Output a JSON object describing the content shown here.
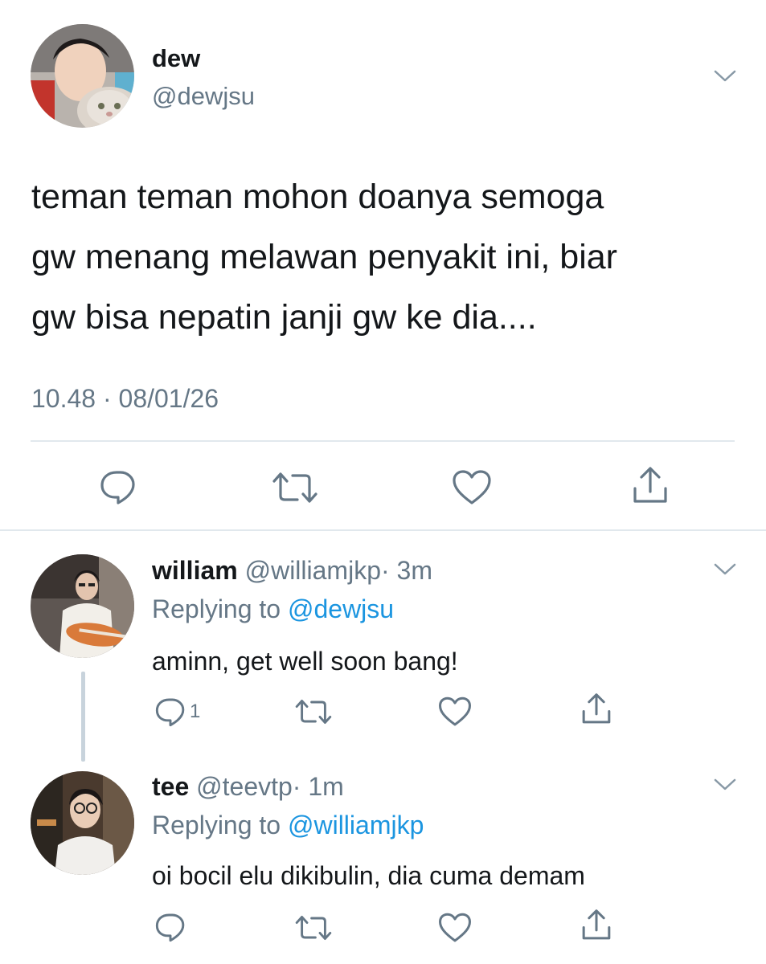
{
  "main_tweet": {
    "display_name": "dew",
    "handle": "@dewjsu",
    "text_lines": [
      "teman teman mohon doanya semoga",
      "gw menang melawan penyakit ini, biar",
      "gw bisa nepatin janji gw ke dia...."
    ],
    "timestamp": "10.48 · 08/01/26",
    "actions": [
      "reply-icon",
      "retweet-icon",
      "like-icon",
      "share-icon"
    ]
  },
  "replies": [
    {
      "display_name": "william",
      "handle": "@williamjkp",
      "time": "· 3m",
      "replying_prefix": "Replying to",
      "replying_to": "@dewjsu",
      "text": "aminn, get well soon bang!",
      "reply_count": "1"
    },
    {
      "display_name": "tee",
      "handle": "@teevtp",
      "time": "· 1m",
      "replying_prefix": "Replying to",
      "replying_to": "@williamjkp",
      "text": "oi bocil elu dikibulin, dia cuma demam",
      "reply_count": ""
    }
  ],
  "colors": {
    "text": "#14171a",
    "secondary": "#657786",
    "link": "#1b95e0",
    "divider": "#e1e8ed",
    "thread_line": "#c8d3dc"
  }
}
